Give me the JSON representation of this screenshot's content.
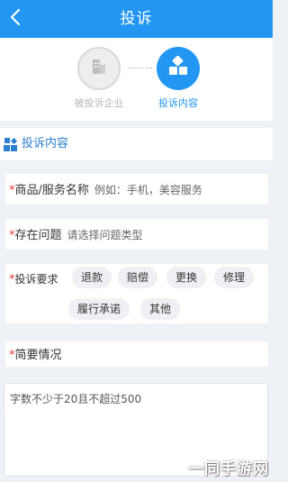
{
  "header": {
    "title": "投诉",
    "back_icon": "chevron-left-icon",
    "color": "#2196f3"
  },
  "steps": [
    {
      "label": "被投诉企业",
      "icon": "building-icon",
      "active": false
    },
    {
      "label": "投诉内容",
      "icon": "grid-icon",
      "active": true
    }
  ],
  "section": {
    "title": "投诉内容",
    "icon": "grid-icon"
  },
  "form": {
    "product": {
      "required": "*",
      "label": "商品/服务名称",
      "placeholder": "例如：手机，美容服务"
    },
    "issue": {
      "required": "*",
      "label": "存在问题",
      "placeholder": "请选择问题类型"
    },
    "request": {
      "required": "*",
      "label": "投诉要求",
      "options": [
        "退款",
        "赔偿",
        "更换",
        "修理",
        "履行承诺",
        "其他"
      ]
    },
    "summary": {
      "required": "*",
      "label": "简要情况",
      "placeholder": "字数不少于20且不超过500"
    }
  },
  "watermark": "一同手游网"
}
